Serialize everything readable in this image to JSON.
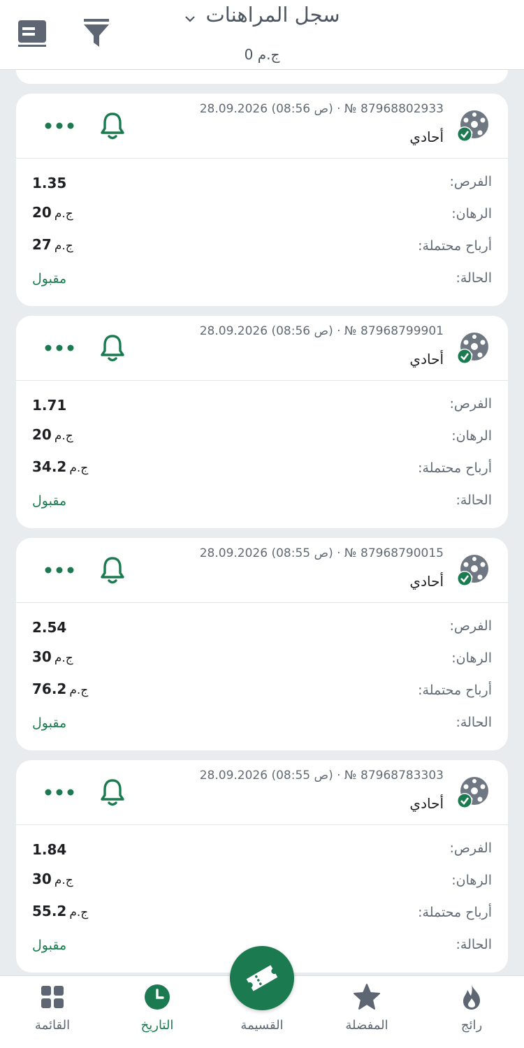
{
  "header": {
    "title": "سجل المراهنات",
    "balance": "ج.م 0"
  },
  "bets": [
    {
      "date": "28.09.2026",
      "time": "(08:56 ص)",
      "number": "№ 87968802933",
      "type": "أحادي",
      "odds_label": "الفرص:",
      "odds": "1.35",
      "stake_label": "الرهان:",
      "stake": "20",
      "stake_currency": "ج.م",
      "win_label": "أرباح محتملة:",
      "win": "27",
      "win_currency": "ج.م",
      "status_label": "الحالة:",
      "status": "مقبول"
    },
    {
      "date": "28.09.2026",
      "time": "(08:56 ص)",
      "number": "№ 87968799901",
      "type": "أحادي",
      "odds_label": "الفرص:",
      "odds": "1.71",
      "stake_label": "الرهان:",
      "stake": "20",
      "stake_currency": "ج.م",
      "win_label": "أرباح محتملة:",
      "win": "34.2",
      "win_currency": "ج.م",
      "status_label": "الحالة:",
      "status": "مقبول"
    },
    {
      "date": "28.09.2026",
      "time": "(08:55 ص)",
      "number": "№ 87968790015",
      "type": "أحادي",
      "odds_label": "الفرص:",
      "odds": "2.54",
      "stake_label": "الرهان:",
      "stake": "30",
      "stake_currency": "ج.م",
      "win_label": "أرباح محتملة:",
      "win": "76.2",
      "win_currency": "ج.م",
      "status_label": "الحالة:",
      "status": "مقبول"
    },
    {
      "date": "28.09.2026",
      "time": "(08:55 ص)",
      "number": "№ 87968783303",
      "type": "أحادي",
      "odds_label": "الفرص:",
      "odds": "1.84",
      "stake_label": "الرهان:",
      "stake": "30",
      "stake_currency": "ج.م",
      "win_label": "أرباح محتملة:",
      "win": "55.2",
      "win_currency": "ج.م",
      "status_label": "الحالة:",
      "status": "مقبول"
    }
  ],
  "nav": {
    "menu": "القائمة",
    "history": "التاريخ",
    "slip": "القسيمة",
    "favorites": "المفضلة",
    "trending": "رائج"
  },
  "colors": {
    "accent": "#1b7a4f",
    "icon_gray": "#5d6672",
    "background": "#e8ecef"
  }
}
